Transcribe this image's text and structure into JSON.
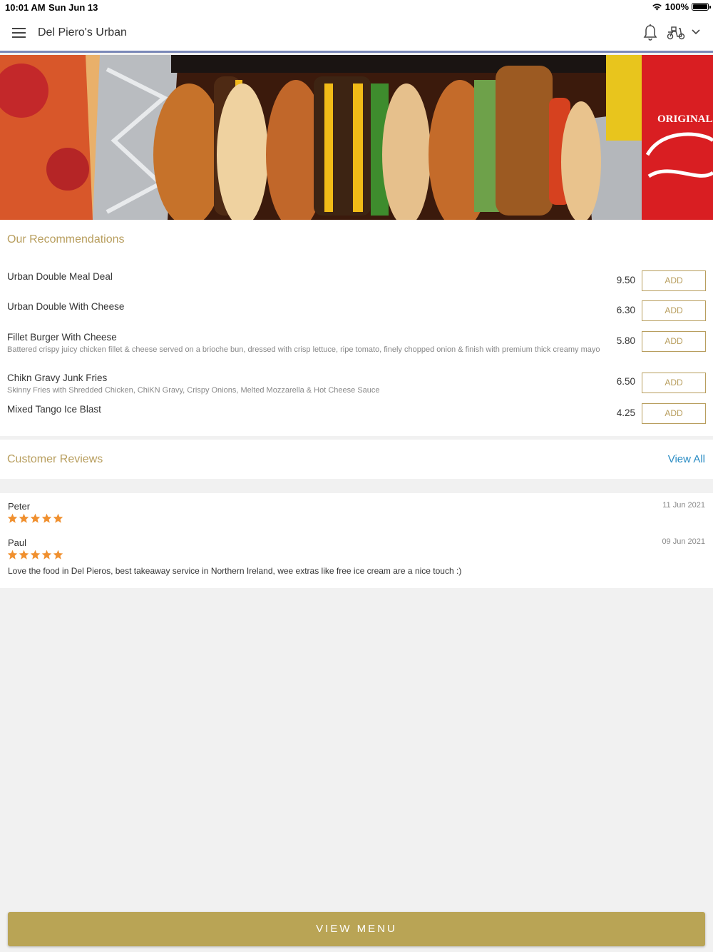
{
  "status_bar": {
    "time": "10:01 AM",
    "date": "Sun Jun 13",
    "battery": "100%"
  },
  "header": {
    "title": "Del Piero's Urban",
    "icons": [
      "menu-icon",
      "bell-icon",
      "scooter-icon",
      "chevron-down-icon"
    ]
  },
  "hero": {
    "image": "burgers, pizza and Coca-Cola can",
    "can_text": "ORIGINAL"
  },
  "recommendations": {
    "title": "Our Recommendations",
    "add_label": "ADD",
    "items": [
      {
        "name": "Urban Double Meal Deal",
        "desc": "",
        "price": "9.50"
      },
      {
        "name": "Urban Double With Cheese",
        "desc": "",
        "price": "6.30"
      },
      {
        "name": "Fillet Burger With Cheese",
        "desc": "Battered crispy juicy chicken fillet & cheese served on a brioche bun, dressed with crisp lettuce, ripe tomato, finely chopped onion & finish with premium thick creamy mayo",
        "price": "5.80"
      },
      {
        "name": "Chikn Gravy Junk Fries",
        "desc": "Skinny Fries with Shredded Chicken, ChiKN Gravy, Crispy Onions, Melted Mozzarella & Hot Cheese Sauce",
        "price": "6.50"
      },
      {
        "name": "Mixed Tango Ice Blast",
        "desc": "",
        "price": "4.25"
      }
    ]
  },
  "reviews": {
    "title": "Customer Reviews",
    "view_all": "View All",
    "items": [
      {
        "name": "Peter",
        "date": "11 Jun 2021",
        "rating": 5,
        "text": ""
      },
      {
        "name": "Paul",
        "date": "09 Jun 2021",
        "rating": 5,
        "text": "Love the food in Del Pieros, best takeaway service in Northern Ireland, wee extras like free ice cream are a nice touch :)"
      }
    ]
  },
  "footer": {
    "view_menu": "VIEW MENU"
  },
  "colors": {
    "accent": "#b9a455",
    "link": "#2a8cc4",
    "star": "#f0902f",
    "nav_border": "#7a88b8"
  }
}
